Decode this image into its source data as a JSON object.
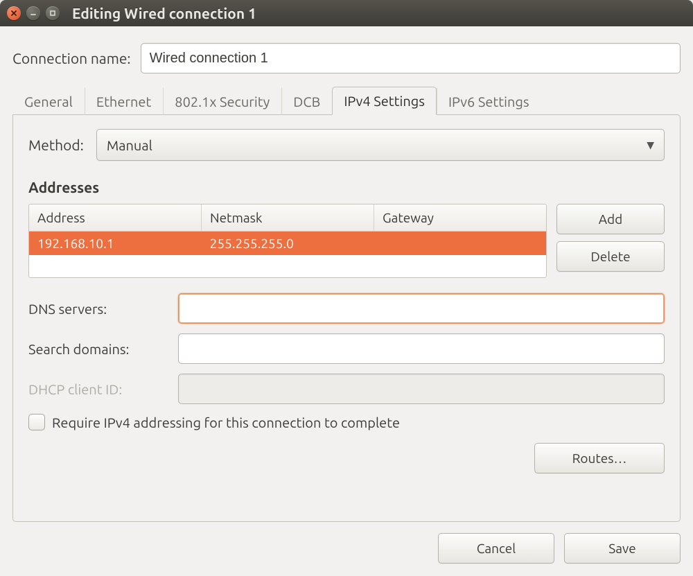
{
  "window_title": "Editing Wired connection 1",
  "connection_name_label": "Connection name:",
  "connection_name_value": "Wired connection 1",
  "tabs": [
    {
      "id": "general",
      "label": "General"
    },
    {
      "id": "ethernet",
      "label": "Ethernet"
    },
    {
      "id": "8021x",
      "label": "802.1x Security"
    },
    {
      "id": "dcb",
      "label": "DCB"
    },
    {
      "id": "ipv4",
      "label": "IPv4 Settings",
      "active": true
    },
    {
      "id": "ipv6",
      "label": "IPv6 Settings"
    }
  ],
  "ipv4": {
    "method_label": "Method:",
    "method_value": "Manual",
    "addresses_label": "Addresses",
    "columns": {
      "address": "Address",
      "netmask": "Netmask",
      "gateway": "Gateway"
    },
    "rows": [
      {
        "address": "192.168.10.1",
        "netmask": "255.255.255.0",
        "gateway": ""
      }
    ],
    "buttons": {
      "add": "Add",
      "delete": "Delete",
      "routes": "Routes…"
    },
    "dns_label": "DNS servers:",
    "dns_value": "",
    "search_label": "Search domains:",
    "search_value": "",
    "dhcp_label": "DHCP client ID:",
    "dhcp_value": "",
    "require_label": "Require IPv4 addressing for this connection to complete"
  },
  "dialog_buttons": {
    "cancel": "Cancel",
    "save": "Save"
  }
}
